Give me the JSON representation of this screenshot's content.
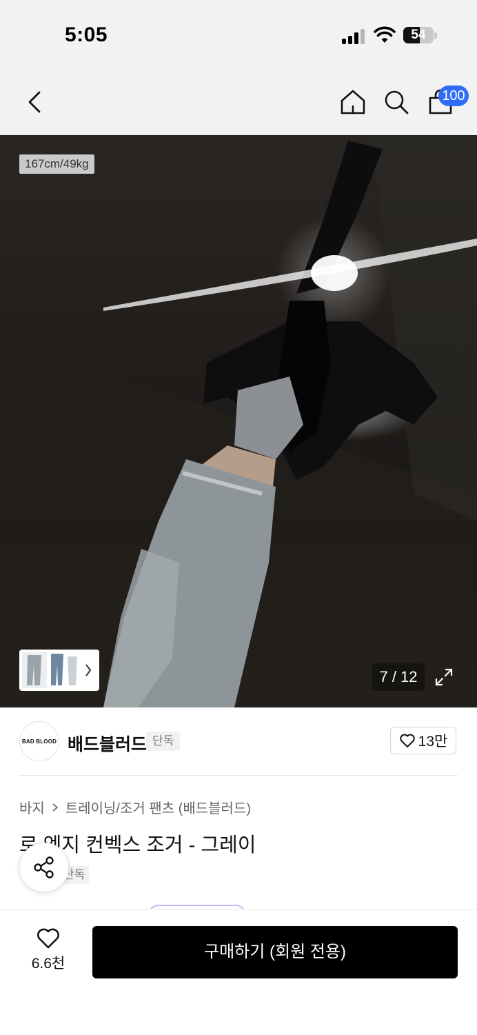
{
  "status_bar": {
    "time": "5:05",
    "battery": "54",
    "battery_level": 0.54
  },
  "nav": {
    "cart_count": "100"
  },
  "gallery": {
    "size_tag": "167cm/49kg",
    "page_current": "7",
    "page_total": "12",
    "page_label": "7 / 12"
  },
  "brand": {
    "logo_text": "BAD BLOOD",
    "name": "배드블러드",
    "tag": "단독",
    "likes": "13만"
  },
  "product": {
    "breadcrumb": [
      "바지",
      "트레이닝/조거 팬츠 (배드블러드)"
    ],
    "title": "로 엣지 컨벡스 조거 - 그레이",
    "tag": "단독"
  },
  "bottom_bar": {
    "wish_count": "6.6천",
    "buy_label": "구매하기 (회원 전용)"
  },
  "colors": {
    "accent_badge": "#2f6df6",
    "buy_button": "#000000",
    "chrome_background": "#f2f2f2"
  },
  "icons": [
    "back-icon",
    "home-icon",
    "search-icon",
    "cart-icon",
    "chevron-right-icon",
    "expand-icon",
    "heart-icon",
    "share-icon"
  ]
}
